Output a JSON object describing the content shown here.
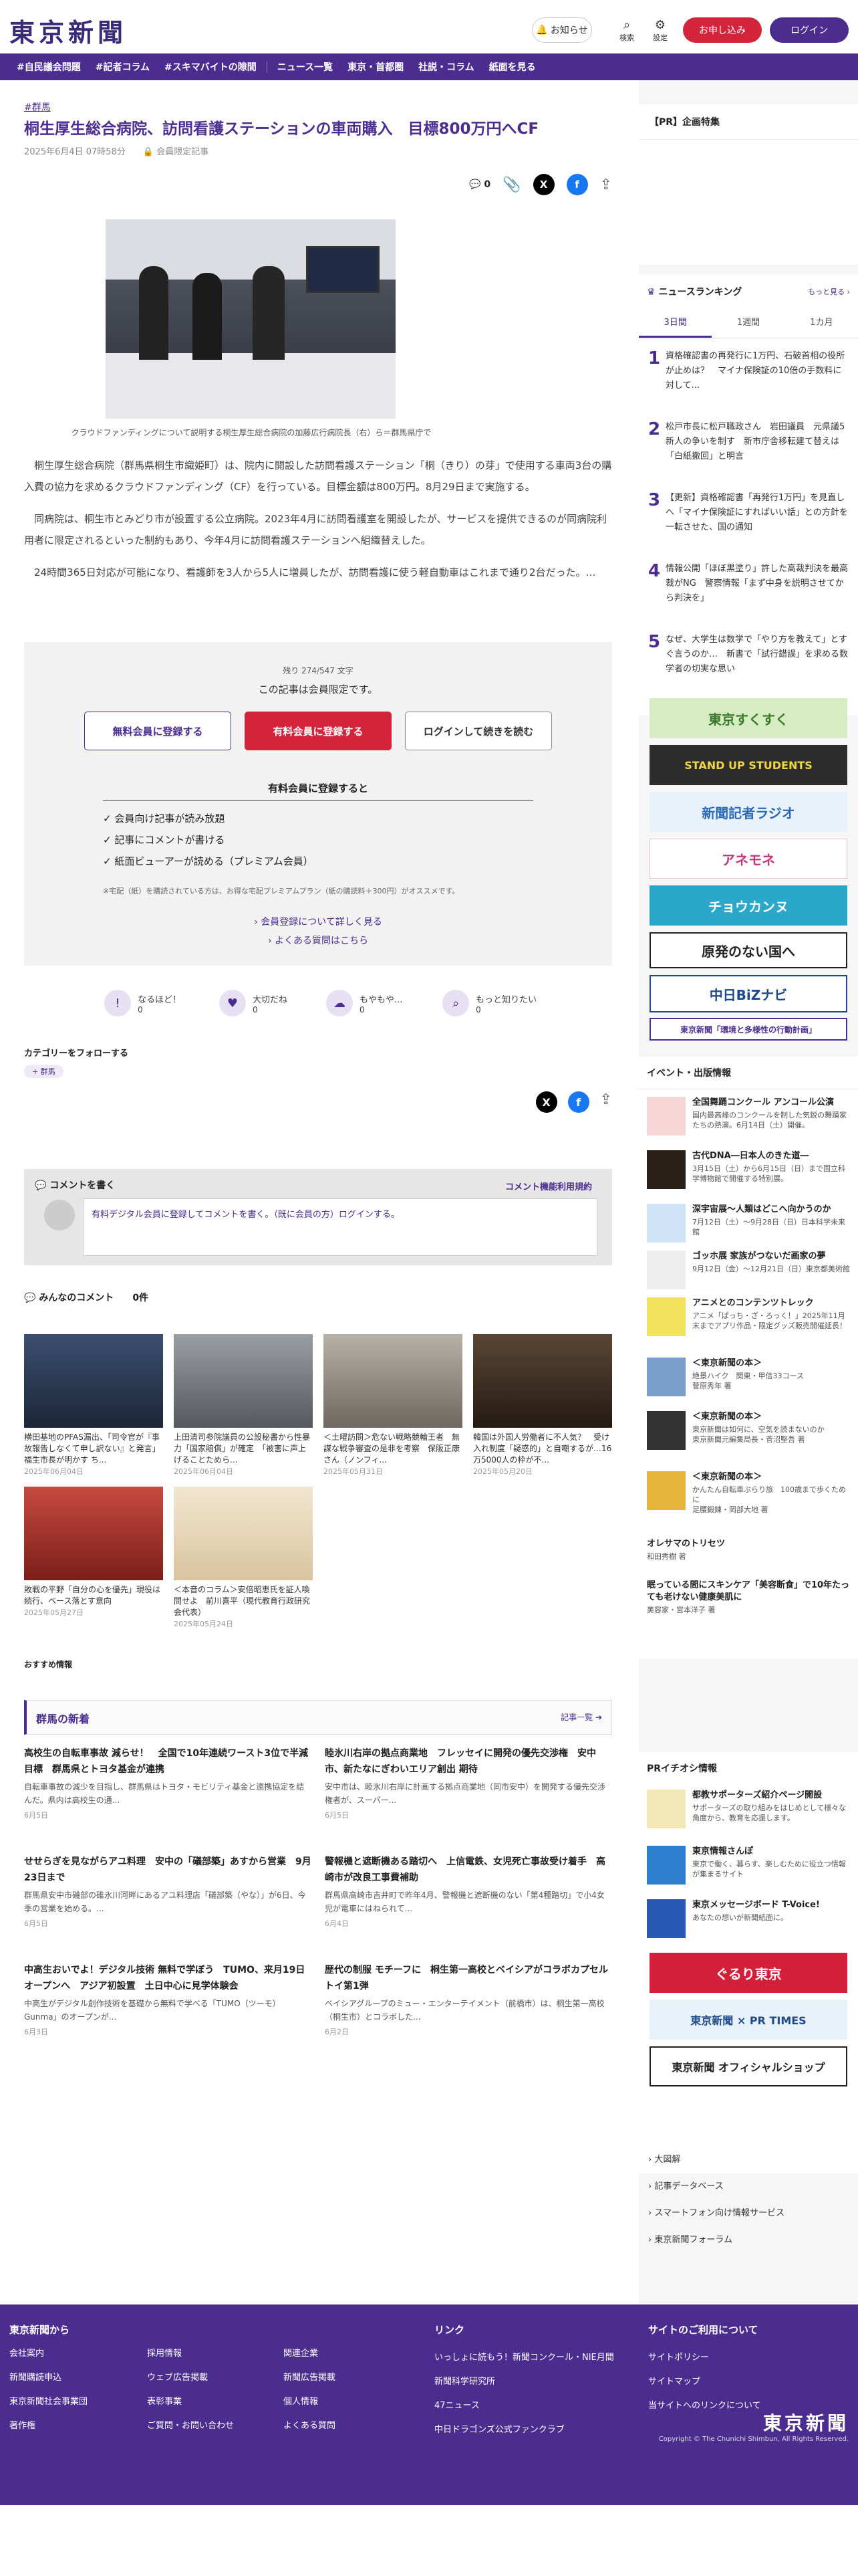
{
  "header": {
    "logo": "東京新聞",
    "notify": "お知らせ",
    "search": "検索",
    "settings": "設定",
    "trial": "お申し込み",
    "login": "ログイン"
  },
  "nav": {
    "items": [
      "#自民議会問題",
      "#記者コラム",
      "#スキマバイトの隙間",
      "ニュース一覧",
      "東京・首都圏",
      "社説・コラム",
      "紙面を見る"
    ]
  },
  "article": {
    "category": "#群馬",
    "title": "桐生厚生総合病院、訪問看護ステーションの車両購入　目標800万円へCF",
    "date": "2025年6月4日 07時58分",
    "members": "会員限定記事",
    "comments_count": "0",
    "caption": "クラウドファンディングについて説明する桐生厚生総合病院の加藤広行病院長（右）ら＝群馬県庁で",
    "paragraphs": [
      "桐生厚生総合病院（群馬県桐生市織姫町）は、院内に開設した訪問看護ステーション「桐（きり）の芽」で使用する車両3台の購入費の協力を求めるクラウドファンディング（CF）を行っている。目標金額は800万円。8月29日まで実施する。",
      "同病院は、桐生市とみどり市が設置する公立病院。2023年4月に訪問看護室を開設したが、サービスを提供できるのが同病院利用者に限定されるといった制約もあり、今年4月に訪問看護ステーションへ組織替えした。",
      "24時間365日対応が可能になり、看護師を3人から5人に増員したが、訪問看護に使う軽自動車はこれまで通り2台だった。…"
    ]
  },
  "paywall": {
    "remaining": "残り 274/547 文字",
    "notice": "この記事は会員限定です。",
    "free_btn": "無料会員に登録する",
    "paid_btn": "有料会員に登録する",
    "login_btn": "ログインして続きを読む",
    "benefits_title": "有料会員に登録すると",
    "benefits": [
      "会員向け記事が読み放題",
      "記事にコメントが書ける",
      "紙面ビューアーが読める（プレミアム会員）"
    ],
    "note": "※宅配（紙）を購読されている方は、お得な宅配プレミアムプラン（紙の購読料＋300円）がオススメです。",
    "link1": "会員登録について詳しく見る",
    "link2": "よくある質問はこちら"
  },
  "reactions": [
    {
      "label": "なるほど！",
      "count": "0"
    },
    {
      "label": "大切だね",
      "count": "0"
    },
    {
      "label": "もやもや...",
      "count": "0"
    },
    {
      "label": "もっと知りたい",
      "count": "0"
    }
  ],
  "follow": {
    "title": "カテゴリーをフォローする",
    "chip": "群馬"
  },
  "comment": {
    "title": "コメントを書く",
    "policy": "コメント機能利用規約",
    "placeholder": "有料デジタル会員に登録してコメントを書く。（既に会員の方）ログインする。"
  },
  "all_comments": {
    "title": "みんなのコメント",
    "count": "0件"
  },
  "related": [
    {
      "title": "横田基地のPFAS漏出、「司令官が『事故報告しなくて申し訳ない』と発言」福生市長が明かす ち...",
      "date": "2025年06月04日"
    },
    {
      "title": "上田清司参院議員の公設秘書から性暴力「国家賠償」が確定　「被害に声上げることためら...",
      "date": "2025年06月04日"
    },
    {
      "title": "＜土曜訪問＞危ない戦略競輪王者　無謀な戦争審査の是非を考察　保阪正康さん（ノンフィ...",
      "date": "2025年05月31日"
    },
    {
      "title": "韓国は外国人労働者に不人気？　受け入れ制度「疑惑的」と自嘲するが…16万5000人の枠が不...",
      "date": "2025年05月20日"
    },
    {
      "title": "敗戦の平野「自分の心を優先」現役は続行、ベース落とす意向",
      "date": "2025年05月27日"
    },
    {
      "title": "＜本音のコラム＞安倍昭恵氏を証人喚問せよ　前川喜平（現代教育行政研究会代表）",
      "date": "2025年05月24日"
    }
  ],
  "recommend_label": "おすすめ情報",
  "gunma": {
    "title": "群馬の新着",
    "more": "記事一覧",
    "items": [
      {
        "title": "高校生の自転車事故 減らせ！　全国で10年連続ワースト3位で半減目標　群馬県とトヨタ基金が連携",
        "desc": "自転車事故の減少を目指し、群馬県はトヨタ・モビリティ基金と連携協定を結んだ。県内は高校生の通...",
        "date": "6月5日"
      },
      {
        "title": "睦氷川右岸の拠点商業地　フレッセイに開発の優先交渉権　安中市、新たなにぎわいエリア創出 期待",
        "desc": "安中市は、睦氷川右岸に計画する拠点商業地（同市安中）を開発する優先交渉権者が、スーパー...",
        "date": "6月5日"
      },
      {
        "title": "せせらぎを見ながらアユ料理　安中の「礒部築」あすから営業　9月23日まで",
        "desc": "群馬県安中市磯部の碓氷川河畔にあるアユ料理店「礒部築（やな）」が6日、今季の営業を始める。...",
        "date": "6月5日"
      },
      {
        "title": "警報機と遮断機ある踏切へ　上信電鉄、女児死亡事故受け着手　高崎市が改良工事費補助",
        "desc": "群馬県高崎市吉井町で昨年4月、警報機と遮断機のない「第4種踏切」で小4女児が電車にはねられて...",
        "date": "6月4日"
      },
      {
        "title": "中高生おいでよ！デジタル技術 無料で学ぼう　TUMO、来月19日オープンへ　アジア初設置　土日中心に見学体験会",
        "desc": "中高生がデジタル創作技術を基礎から無料で学べる「TUMO（ツーモ）Gunma」のオープンが...",
        "date": "6月3日"
      },
      {
        "title": "歴代の制服 モチーフに　桐生第一高校とベイシアがコラボカプセルトイ第1弾",
        "desc": "ベイシアグループのミュー・エンターテイメント（前橋市）は、桐生第一高校（桐生市）とコラボした...",
        "date": "6月2日"
      }
    ]
  },
  "sidebar": {
    "pr": "【PR】企画特集",
    "ranking_title": "ニュースランキング",
    "ranking_more": "もっと見る",
    "tabs": [
      "3日間",
      "1週間",
      "1カ月"
    ],
    "ranking": [
      {
        "n": "1",
        "t": "資格確認書の再発行に1万円、石破首相の役所が止めは？　マイナ保険証の10倍の手数料に対して..."
      },
      {
        "n": "2",
        "t": "松戸市長に松戸職政さん　岩田議員　元県議5新人の争いを制す　新市庁舎移転建て替えは「白紙撤回」と明言"
      },
      {
        "n": "3",
        "t": "【更新】資格確認書「再発行1万円」を見直し へ「マイナ保険証にすればいい話」との方針を一転させた、国の通知"
      },
      {
        "n": "4",
        "t": "情報公開「ほぼ黒塗り」許した高裁判決を最高裁がNG　警察情報「まず中身を説明させてから判決を」"
      },
      {
        "n": "5",
        "t": "なぜ、大学生は数学で「やり方を教えて」とすぐ言うのか…　新書で「試行錯誤」を求める数学者の切実な思い"
      }
    ],
    "banners": [
      "東京すくすく",
      "STAND UP STUDENTS",
      "新聞記者ラジオ",
      "アネモネ",
      "チョウカンヌ",
      "原発のない国へ",
      "中日BiZナビ",
      "東京新聞「環境と多様性の行動計画」"
    ],
    "events_title": "イベント・出版情報",
    "events": [
      {
        "t": "全国舞踊コンクール アンコール公演",
        "d": "国内最高峰のコンクールを制した気鋭の舞踊家たちの熱演。6月14日（土）開催。"
      },
      {
        "t": "古代DNA―日本人のきた道―",
        "d": "3月15日（土）から6月15日（日）まで国立科学博物館で開催する特別展。"
      },
      {
        "t": "深宇宙展～人類はどこへ向かうのか",
        "d": "7月12日（土）～9月28日（日）日本科学未来館"
      },
      {
        "t": "ゴッホ展 家族がつないだ画家の夢",
        "d": "9月12日（金）～12月21日（日）東京都美術館"
      },
      {
        "t": "アニメとのコンテンツトレック",
        "d": "アニメ「ぱっち・ざ・ろっく！」2025年11月末までアプリ作品・限定グッズ販売開催延長！"
      },
      {
        "t": "＜東京新聞の本＞",
        "d": "絶景ハイク　関東・甲信33コース\n菅原秀年 著"
      },
      {
        "t": "＜東京新聞の本＞",
        "d": "東京新聞は如何に、空気を読まないのか\n東京新聞元編集局長・菅沼堅吾 著"
      },
      {
        "t": "＜東京新聞の本＞",
        "d": "かんたん自転車ぶらり旅　100歳まで歩くために\n足腰鍛錬・岡部大地 著"
      },
      {
        "t": "オレサマのトリセツ",
        "d": "和田秀樹 著"
      },
      {
        "t": "眠っている間にスキンケア「美容断食」で10年たっても老けない健康美肌に",
        "d": "美容家・宮本洋子 著"
      }
    ],
    "pr_title": "PRイチオシ情報",
    "pr_items": [
      {
        "t": "都教サポーターズ紹介ページ開設",
        "d": "サポーターズの取り組みをはじめとして様々な角度から、教育を応援します。"
      },
      {
        "t": "東京情報さんぽ",
        "d": "東京で働く、暮らす、楽しむために役立つ情報が集まるサイト"
      },
      {
        "t": "東京メッセージボード T-Voice!",
        "d": "あなたの想いが新聞紙面に。"
      }
    ],
    "bottom_banners": [
      "ぐるり東京",
      "東京新聞 × PR TIMES",
      "東京新聞 オフィシャルショップ"
    ],
    "links": [
      "大図解",
      "記事データベース",
      "スマートフォン向け情報サービス",
      "東京新聞フォーラム"
    ]
  },
  "footer": {
    "col1_title": "東京新聞から",
    "col1": [
      "会社案内",
      "新聞購読申込",
      "東京新聞社会事業団",
      "著作権"
    ],
    "col1b": [
      "採用情報",
      "ウェブ広告掲載",
      "表彰事業",
      "ご質問・お問い合わせ"
    ],
    "col1c": [
      "関連企業",
      "新聞広告掲載",
      "個人情報",
      "よくある質問"
    ],
    "col2_title": "リンク",
    "col2": [
      "いっしょに読もう！新聞コンクール・NIE月間",
      "新聞科学研究所",
      "47ニュース",
      "中日ドラゴンズ公式ファンクラブ"
    ],
    "col3_title": "サイトのご利用について",
    "col3": [
      "サイトポリシー",
      "サイトマップ",
      "当サイトへのリンクについて"
    ],
    "logo": "東京新聞",
    "copyright": "Copyright © The Chunichi Shimbun, All Rights Reserved."
  },
  "colors": {
    "brand": "#4b2c8f",
    "accent": "#d3243c"
  }
}
